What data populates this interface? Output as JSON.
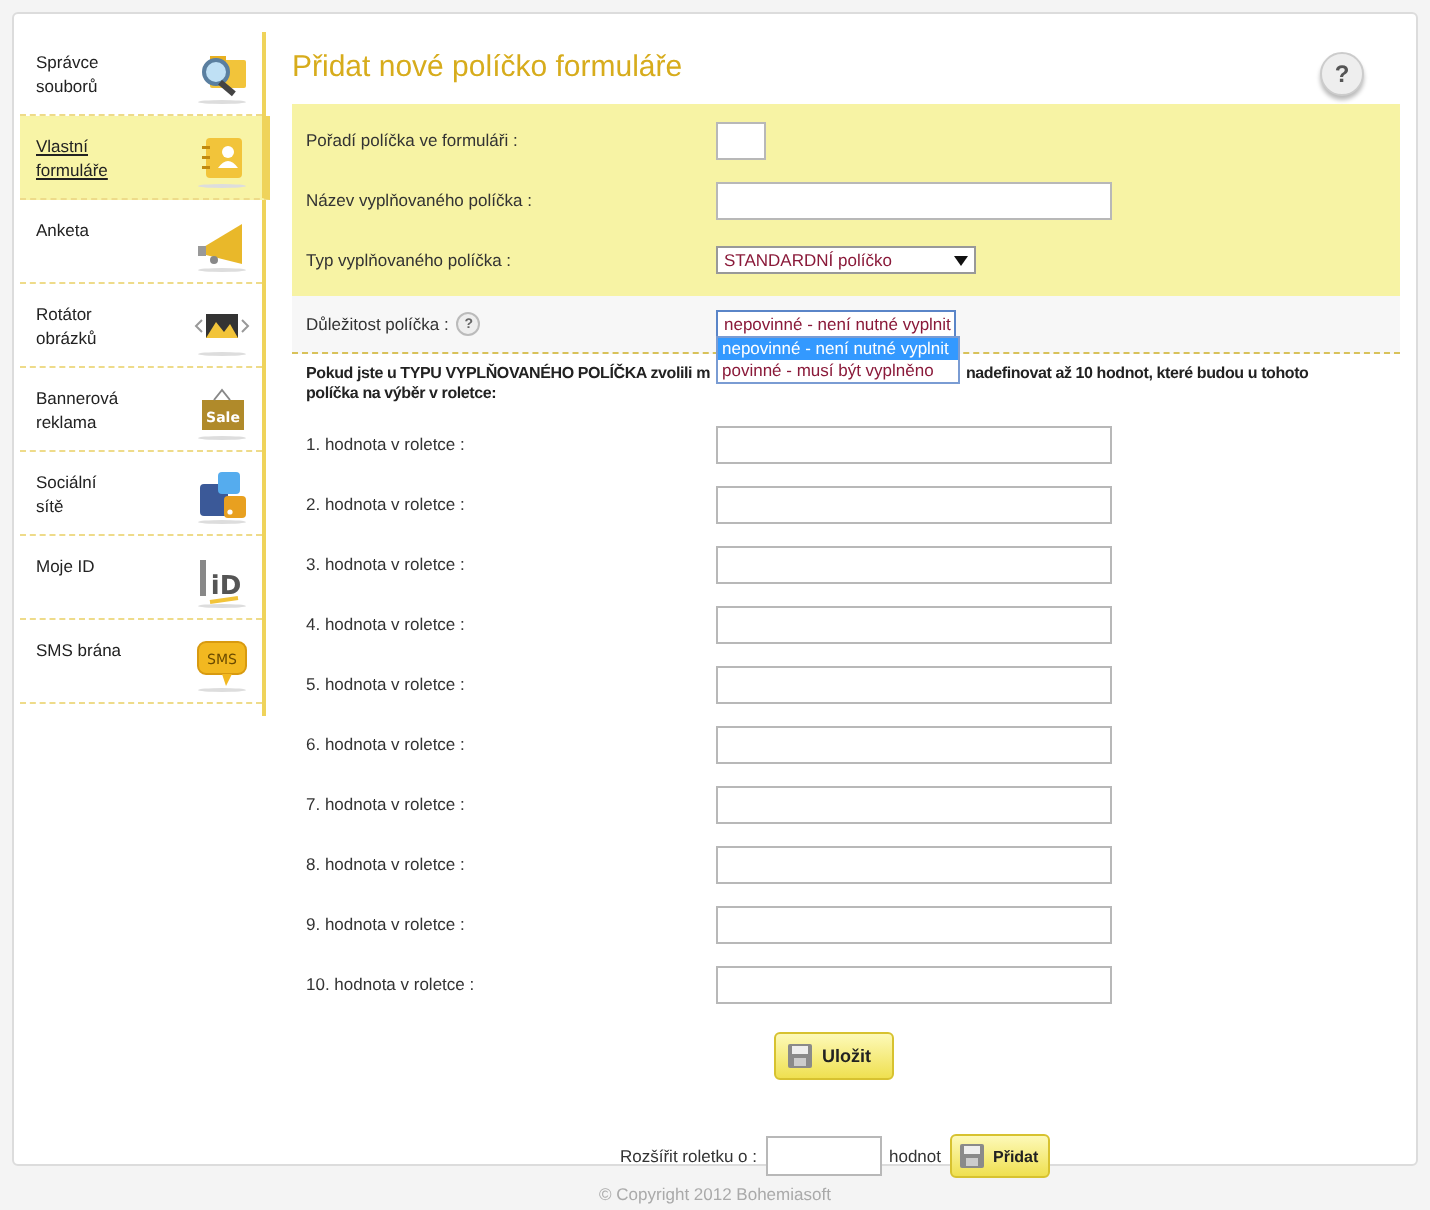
{
  "sidebar": {
    "items": [
      {
        "label": "Správce\nsouborů",
        "kind": "search-folder",
        "selected": false
      },
      {
        "label": "Vlastní\nformuláře",
        "kind": "contact-card",
        "selected": true
      },
      {
        "label": "Anketa",
        "kind": "megaphone",
        "selected": false
      },
      {
        "label": "Rotátor\nobrázků",
        "kind": "image-slider",
        "selected": false
      },
      {
        "label": "Bannerová\nreklama",
        "kind": "sale-tag",
        "badge": "Sale",
        "selected": false
      },
      {
        "label": "Sociální\nsítě",
        "kind": "social",
        "selected": false
      },
      {
        "label": "Moje ID",
        "kind": "id",
        "badge": "iD",
        "selected": false
      },
      {
        "label": "SMS brána",
        "kind": "sms",
        "badge": "SMS",
        "selected": false
      }
    ]
  },
  "page": {
    "title": "Přidat nové políčko formuláře",
    "help": "?"
  },
  "main_fields": [
    {
      "label": "Pořadí políčka ve formuláři :",
      "kind": "short-text"
    },
    {
      "label": "Název vyplňovaného políčka  :",
      "kind": "text"
    },
    {
      "label": "Typ vyplňovaného políčka  :",
      "kind": "select",
      "value": "STANDARDNÍ políčko"
    }
  ],
  "importance": {
    "label": "Důležitost políčka  :",
    "help": "?",
    "value": "nepovinné - není nutné vyplnit",
    "expanded": true,
    "options": [
      {
        "label": "nepovinné - není nutné vyplnit",
        "selected": true
      },
      {
        "label": "povinné - musí být vyplněno",
        "selected": false
      }
    ]
  },
  "note": {
    "line_1_start": "Pokud jste u TYPU VYPLŇOVANÉHO POLÍČKA zvolili m",
    "line_1_end": "nadefinovat až 10 hodnot, které budou u tohoto",
    "line_2": "políčka na výběr v roletce:"
  },
  "value_fields": [
    "1. hodnota v roletce  :",
    "2. hodnota v roletce  :",
    "3. hodnota v roletce  :",
    "4. hodnota v roletce  :",
    "5. hodnota v roletce  :",
    "6. hodnota v roletce  :",
    "7. hodnota v roletce  :",
    "8. hodnota v roletce  :",
    "9. hodnota v roletce  :",
    "10. hodnota v roletce  :"
  ],
  "save_button": "Uložit",
  "extend": {
    "label": "Rozšířit roletku o  :",
    "unit": "hodnot",
    "button": "Přidat"
  },
  "footer": "© Copyright 2012 Bohemiasoft"
}
